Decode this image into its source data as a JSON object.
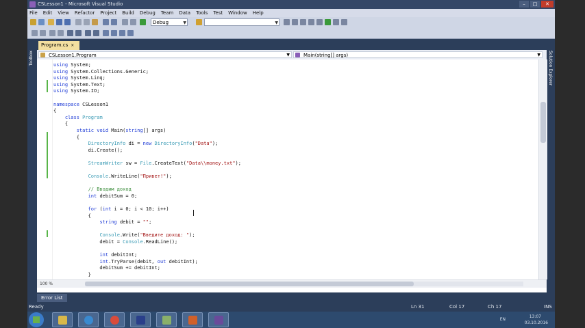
{
  "window": {
    "title": "CSLesson1 - Microsoft Visual Studio"
  },
  "menu": [
    "File",
    "Edit",
    "View",
    "Refactor",
    "Project",
    "Build",
    "Debug",
    "Team",
    "Data",
    "Tools",
    "Test",
    "Window",
    "Help"
  ],
  "toolbar": {
    "configuration": "Debug"
  },
  "sidebar": {
    "toolbox_label": "Toolbox",
    "right_label": "Solution Explorer"
  },
  "editor": {
    "tab_label": "Program.cs",
    "tab_close": "×",
    "nav_left": "CSLesson1.Program",
    "nav_right": "Main(string[] args)",
    "zoom": "100 %",
    "code": [
      [
        {
          "t": "kw",
          "v": "using"
        },
        {
          "t": "",
          "v": " System;"
        }
      ],
      [
        {
          "t": "kw",
          "v": "using"
        },
        {
          "t": "",
          "v": " System.Collections.Generic;"
        }
      ],
      [
        {
          "t": "kw",
          "v": "using"
        },
        {
          "t": "",
          "v": " System.Linq;"
        }
      ],
      [
        {
          "t": "kw",
          "v": "using"
        },
        {
          "t": "",
          "v": " System.Text;"
        }
      ],
      [
        {
          "t": "kw",
          "v": "using"
        },
        {
          "t": "",
          "v": " System.IO;"
        }
      ],
      [],
      [
        {
          "t": "kw",
          "v": "namespace"
        },
        {
          "t": "",
          "v": " CSLesson1"
        }
      ],
      [
        {
          "t": "",
          "v": "{"
        }
      ],
      [
        {
          "t": "",
          "v": "    "
        },
        {
          "t": "kw",
          "v": "class"
        },
        {
          "t": "",
          "v": " "
        },
        {
          "t": "ty",
          "v": "Program"
        }
      ],
      [
        {
          "t": "",
          "v": "    {"
        }
      ],
      [
        {
          "t": "",
          "v": "        "
        },
        {
          "t": "kw",
          "v": "static"
        },
        {
          "t": "",
          "v": " "
        },
        {
          "t": "kw",
          "v": "void"
        },
        {
          "t": "",
          "v": " Main("
        },
        {
          "t": "kw",
          "v": "string"
        },
        {
          "t": "",
          "v": "[] args)"
        }
      ],
      [
        {
          "t": "",
          "v": "        {"
        }
      ],
      [
        {
          "t": "",
          "v": "            "
        },
        {
          "t": "ty",
          "v": "DirectoryInfo"
        },
        {
          "t": "",
          "v": " di = "
        },
        {
          "t": "kw",
          "v": "new"
        },
        {
          "t": "",
          "v": " "
        },
        {
          "t": "ty",
          "v": "DirectoryInfo"
        },
        {
          "t": "",
          "v": "("
        },
        {
          "t": "st",
          "v": "\"Data\""
        },
        {
          "t": "",
          "v": ");"
        }
      ],
      [
        {
          "t": "",
          "v": "            di.Create();"
        }
      ],
      [],
      [
        {
          "t": "",
          "v": "            "
        },
        {
          "t": "ty",
          "v": "StreamWriter"
        },
        {
          "t": "",
          "v": " sw = "
        },
        {
          "t": "ty",
          "v": "File"
        },
        {
          "t": "",
          "v": ".CreateText("
        },
        {
          "t": "st",
          "v": "\"Data\\\\money.txt\""
        },
        {
          "t": "",
          "v": ");"
        }
      ],
      [],
      [
        {
          "t": "",
          "v": "            "
        },
        {
          "t": "ty",
          "v": "Console"
        },
        {
          "t": "",
          "v": ".WriteLine("
        },
        {
          "t": "st",
          "v": "\"Привет!\""
        },
        {
          "t": "",
          "v": ");"
        }
      ],
      [],
      [
        {
          "t": "",
          "v": "            "
        },
        {
          "t": "cm",
          "v": "// Вводим доход"
        }
      ],
      [
        {
          "t": "",
          "v": "            "
        },
        {
          "t": "kw",
          "v": "int"
        },
        {
          "t": "",
          "v": " debitSum = 0;"
        }
      ],
      [],
      [
        {
          "t": "",
          "v": "            "
        },
        {
          "t": "kw",
          "v": "for"
        },
        {
          "t": "",
          "v": " ("
        },
        {
          "t": "kw",
          "v": "int"
        },
        {
          "t": "",
          "v": " i = 0; i < 10; i++)"
        }
      ],
      [
        {
          "t": "",
          "v": "            {"
        }
      ],
      [
        {
          "t": "",
          "v": "                "
        },
        {
          "t": "kw",
          "v": "string"
        },
        {
          "t": "",
          "v": " debit = "
        },
        {
          "t": "st",
          "v": "\"\""
        },
        {
          "t": "",
          "v": ";"
        }
      ],
      [],
      [
        {
          "t": "",
          "v": "                "
        },
        {
          "t": "ty",
          "v": "Console"
        },
        {
          "t": "",
          "v": ".Write("
        },
        {
          "t": "st",
          "v": "\"Введите доход: \""
        },
        {
          "t": "",
          "v": ");"
        }
      ],
      [
        {
          "t": "",
          "v": "                debit = "
        },
        {
          "t": "ty",
          "v": "Console"
        },
        {
          "t": "",
          "v": ".ReadLine();"
        }
      ],
      [],
      [
        {
          "t": "",
          "v": "                "
        },
        {
          "t": "kw",
          "v": "int"
        },
        {
          "t": "",
          "v": " debitInt;"
        }
      ],
      [
        {
          "t": "",
          "v": "                "
        },
        {
          "t": "kw",
          "v": "int"
        },
        {
          "t": "",
          "v": ".TryParse(debit, "
        },
        {
          "t": "kw",
          "v": "out"
        },
        {
          "t": "",
          "v": " debitInt);"
        }
      ],
      [
        {
          "t": "",
          "v": "                debitSum += debitInt;"
        }
      ],
      [
        {
          "t": "",
          "v": "            }"
        }
      ]
    ]
  },
  "panels": {
    "error_list": "Error List"
  },
  "status": {
    "ready": "Ready",
    "ln": "Ln 31",
    "col": "Col 17",
    "ch": "Ch 17",
    "ins": "INS"
  },
  "tray": {
    "lang": "EN",
    "time": "13:07",
    "date": "03.10.2016"
  }
}
